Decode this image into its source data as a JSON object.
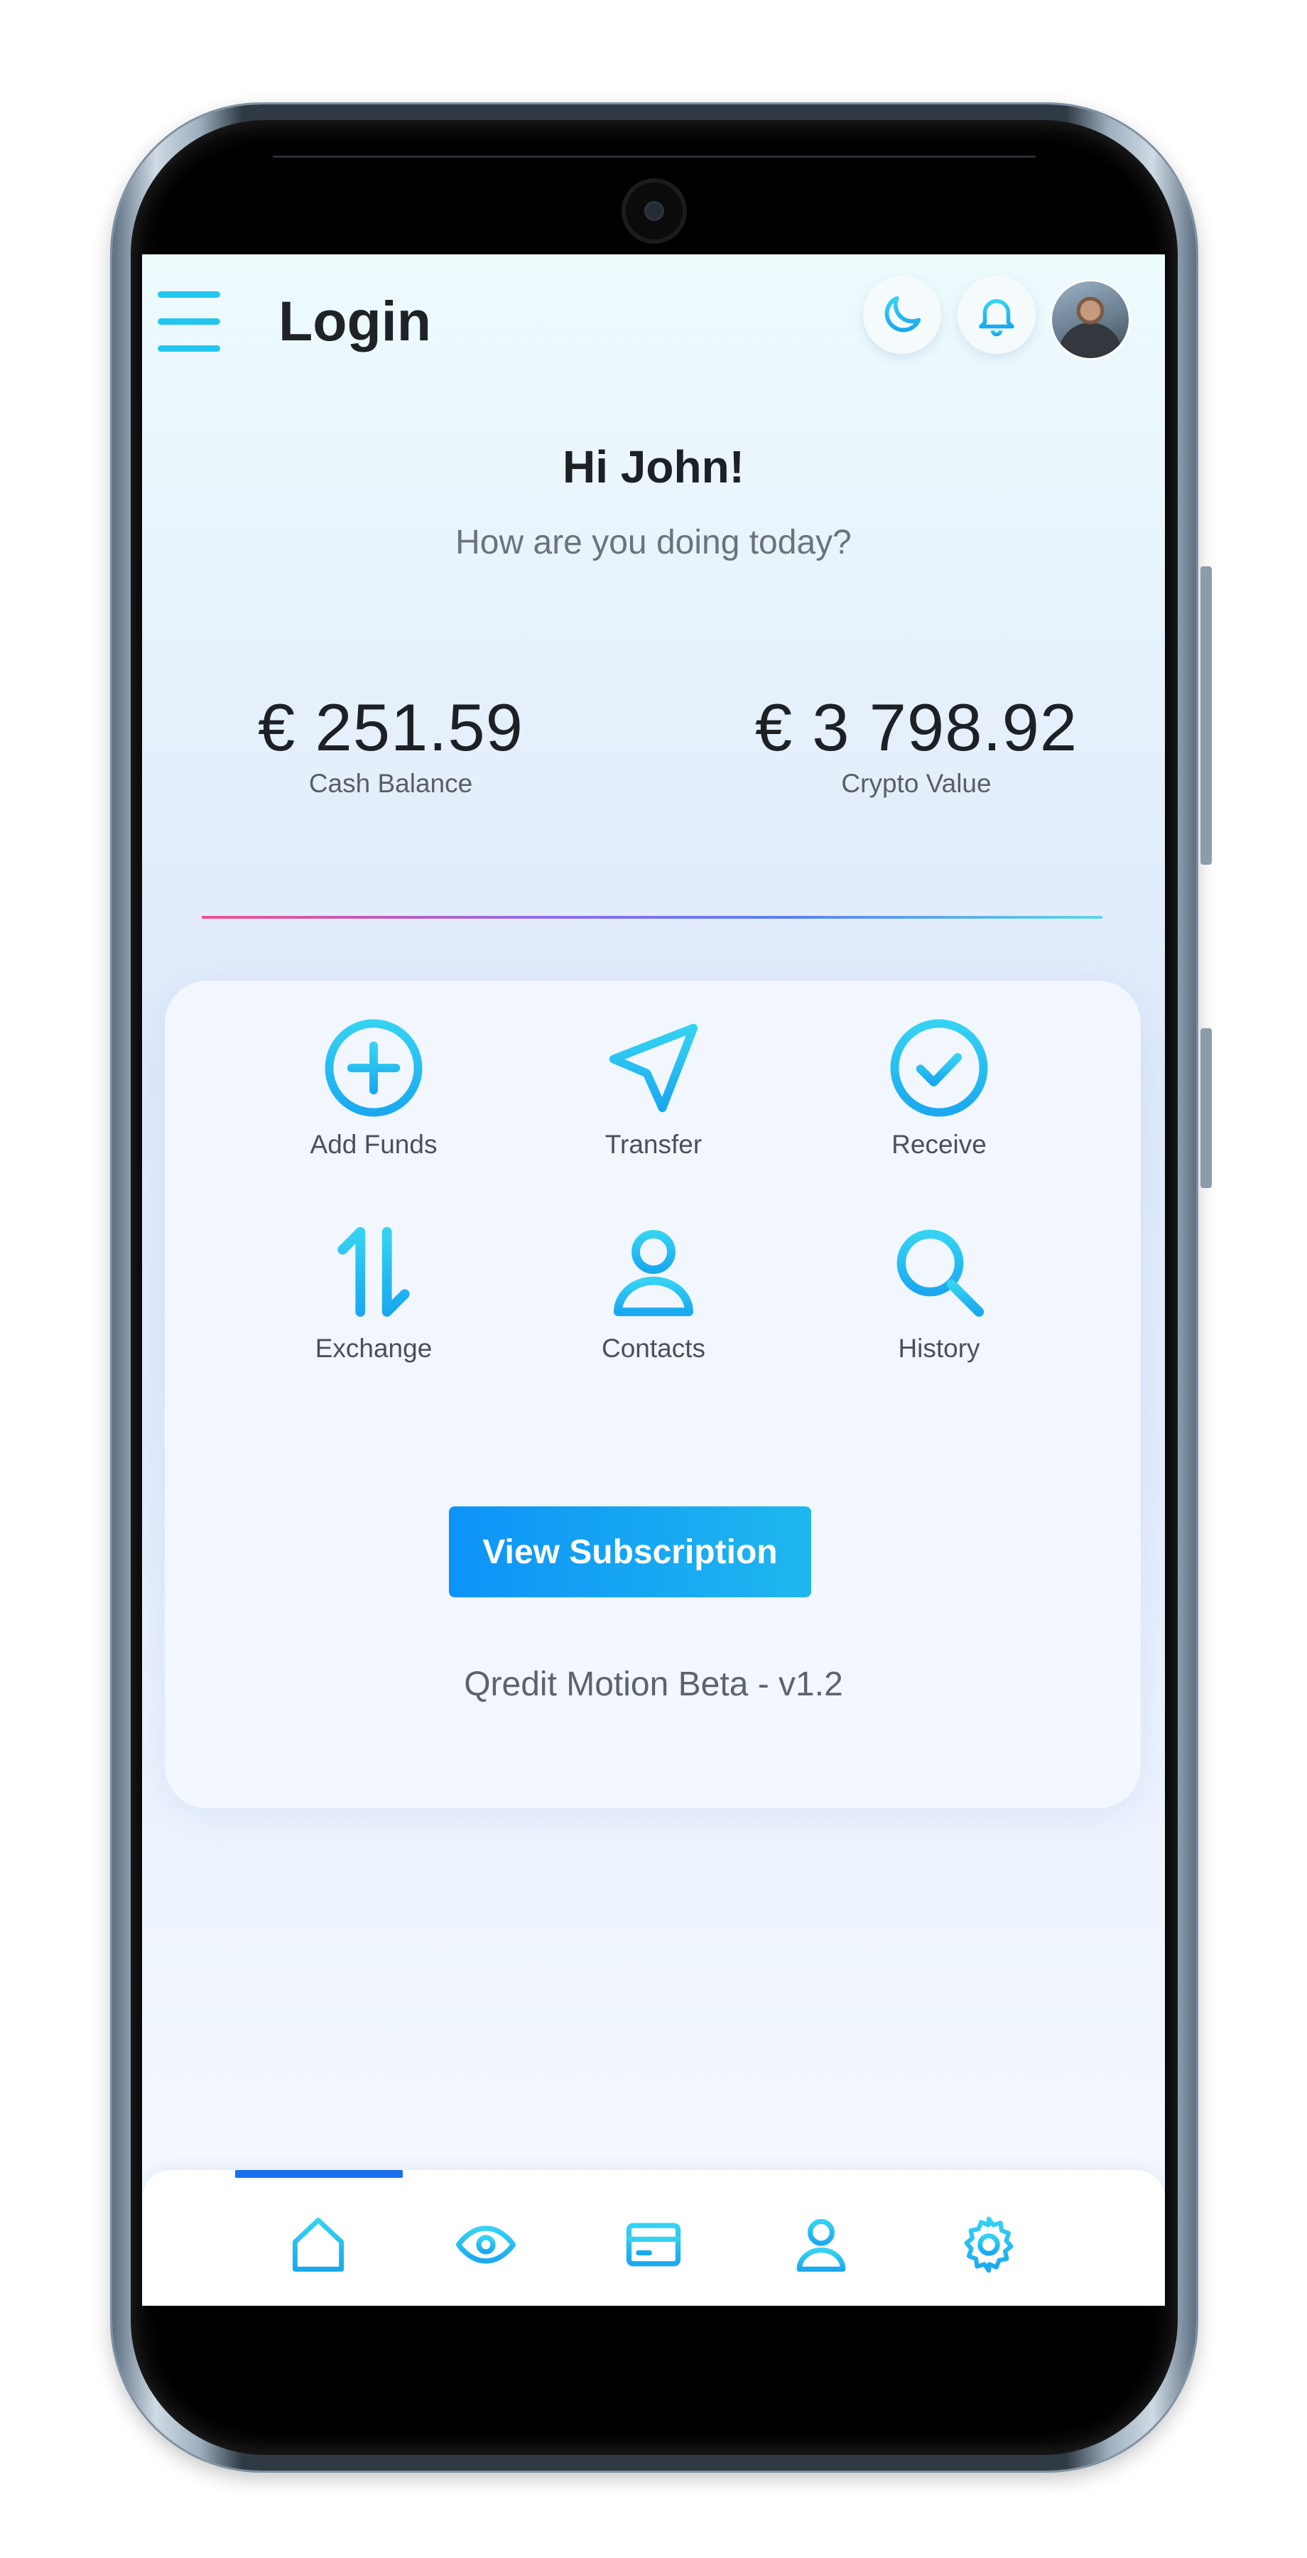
{
  "header": {
    "title": "Login",
    "menu_icon": "hamburger-menu-icon",
    "theme_icon": "moon-icon",
    "notifications_icon": "bell-icon",
    "avatar": "user-avatar"
  },
  "greeting": {
    "headline": "Hi John!",
    "subtitle": "How are you doing today?"
  },
  "balances": [
    {
      "amount": "€ 251.59",
      "label": "Cash Balance"
    },
    {
      "amount": "€ 3 798.92",
      "label": "Crypto Value"
    }
  ],
  "actions": [
    {
      "label": "Add Funds",
      "icon": "plus-circle-icon"
    },
    {
      "label": "Transfer",
      "icon": "send-icon"
    },
    {
      "label": "Receive",
      "icon": "check-circle-icon"
    },
    {
      "label": "Exchange",
      "icon": "swap-arrows-icon"
    },
    {
      "label": "Contacts",
      "icon": "user-icon"
    },
    {
      "label": "History",
      "icon": "search-icon"
    }
  ],
  "cta": {
    "label": "View Subscription"
  },
  "footer": {
    "version": "Qredit Motion Beta - v1.2"
  },
  "bottom_nav": [
    {
      "icon": "home-icon",
      "active": true
    },
    {
      "icon": "eye-icon",
      "active": false
    },
    {
      "icon": "card-icon",
      "active": false
    },
    {
      "icon": "profile-icon",
      "active": false
    },
    {
      "icon": "gear-icon",
      "active": false
    }
  ],
  "colors": {
    "accent": "#22c6ee",
    "nav_indicator": "#1a6ff0",
    "button_start": "#0d93f7",
    "button_end": "#1fb7ee"
  }
}
